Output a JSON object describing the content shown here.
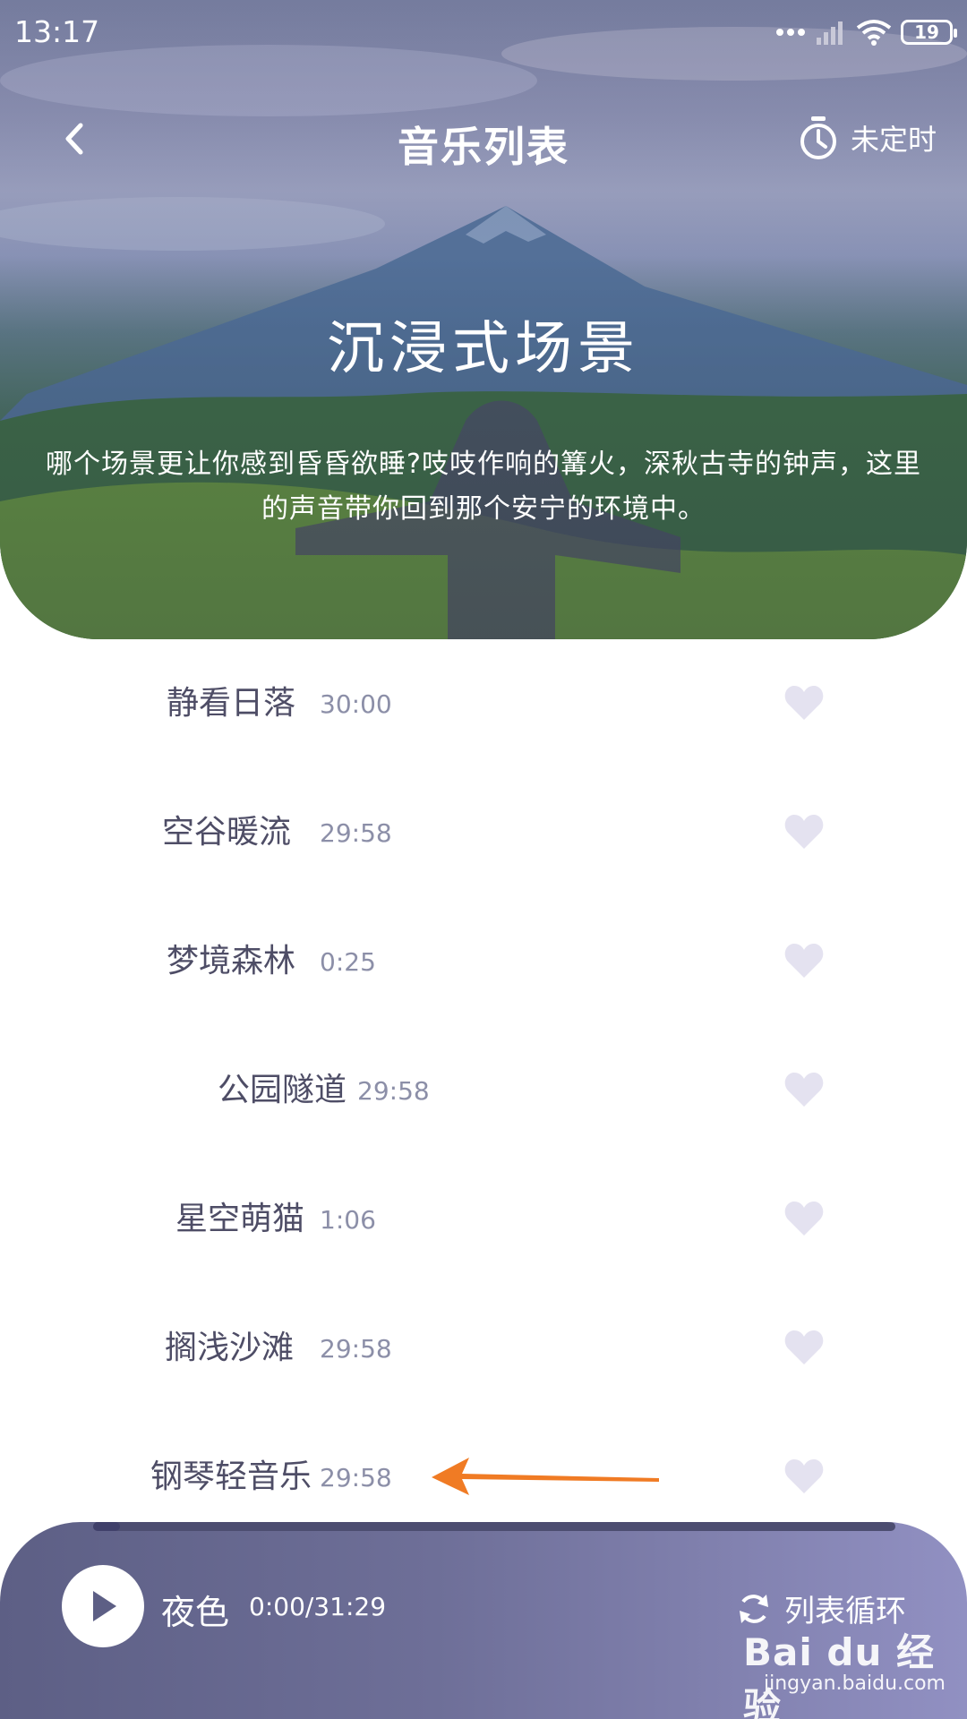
{
  "status_bar": {
    "time": "13:17",
    "battery": "19"
  },
  "header": {
    "title": "音乐列表",
    "timer_label": "未定时"
  },
  "scene": {
    "title": "沉浸式场景",
    "description": "哪个场景更让你感到昏昏欲睡?吱吱作响的篝火，深秋古寺的钟声，这里的声音带你回到那个安宁的环境中。"
  },
  "tracks": [
    {
      "name": "静看日落",
      "duration": "30:00"
    },
    {
      "name": "空谷暖流",
      "duration": "29:58"
    },
    {
      "name": "梦境森林",
      "duration": "0:25"
    },
    {
      "name": "公园隧道",
      "duration": "29:58"
    },
    {
      "name": "星空萌猫",
      "duration": "1:06"
    },
    {
      "name": "搁浅沙滩",
      "duration": "29:58"
    },
    {
      "name": "钢琴轻音乐",
      "duration": "29:58"
    }
  ],
  "player": {
    "title": "夜色",
    "time": "0:00/31:29",
    "progress_fraction": 0.0,
    "loop_label": "列表循环"
  },
  "watermark": {
    "brand": "Bai du 经验",
    "url": "jingyan.baidu.com"
  },
  "colors": {
    "accent_player": "#6e6f98",
    "heart_color": "#e4e2f0",
    "annotation_arrow": "#f07b24"
  }
}
